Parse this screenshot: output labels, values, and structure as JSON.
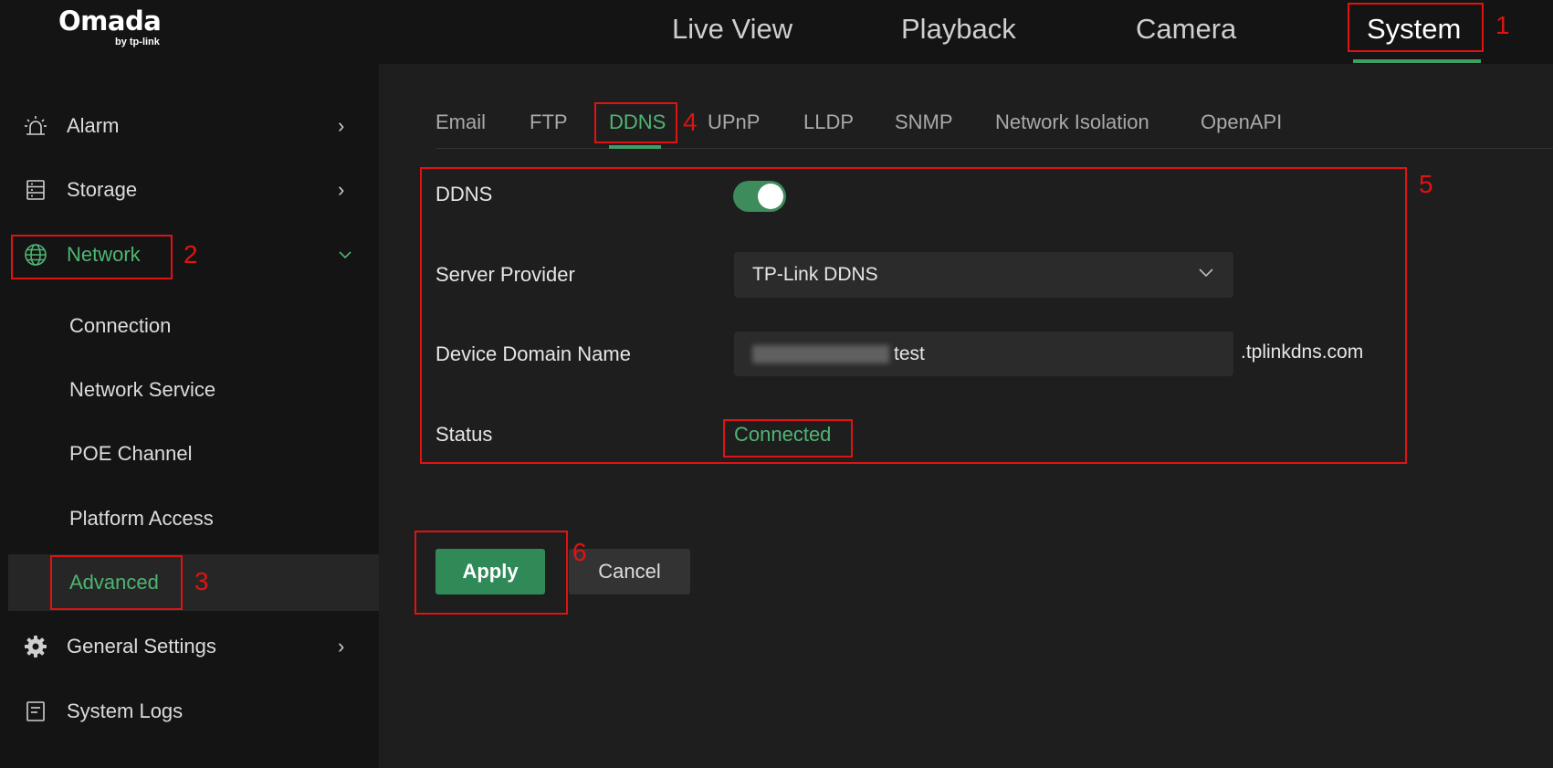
{
  "brand": {
    "name": "Omada",
    "byline": "by tp-link"
  },
  "top_nav": [
    {
      "label": "Live View"
    },
    {
      "label": "Playback"
    },
    {
      "label": "Camera"
    },
    {
      "label": "System"
    }
  ],
  "sidebar": {
    "alarm": {
      "label": "Alarm",
      "icon": "alarm-icon"
    },
    "storage": {
      "label": "Storage",
      "icon": "storage-icon"
    },
    "network": {
      "label": "Network",
      "icon": "globe-icon",
      "sub": [
        "Connection",
        "Network Service",
        "POE Channel",
        "Platform Access",
        "Advanced"
      ]
    },
    "general": {
      "label": "General Settings",
      "icon": "gear-icon"
    },
    "logs": {
      "label": "System Logs",
      "icon": "document-icon"
    }
  },
  "tabs": [
    "Email",
    "FTP",
    "DDNS",
    "UPnP",
    "LLDP",
    "SNMP",
    "Network Isolation",
    "OpenAPI"
  ],
  "form": {
    "ddns_label": "DDNS",
    "ddns_enabled": true,
    "provider_label": "Server Provider",
    "provider_value": "TP-Link DDNS",
    "domain_label": "Device Domain Name",
    "domain_value": "test",
    "domain_suffix": ".tplinkdns.com",
    "status_label": "Status",
    "status_value": "Connected"
  },
  "buttons": {
    "apply": "Apply",
    "cancel": "Cancel"
  },
  "annotations": [
    "1",
    "2",
    "3",
    "4",
    "5",
    "6"
  ],
  "colors": {
    "accent": "#4fb572",
    "annotation": "#e01313",
    "background": "#141414"
  }
}
